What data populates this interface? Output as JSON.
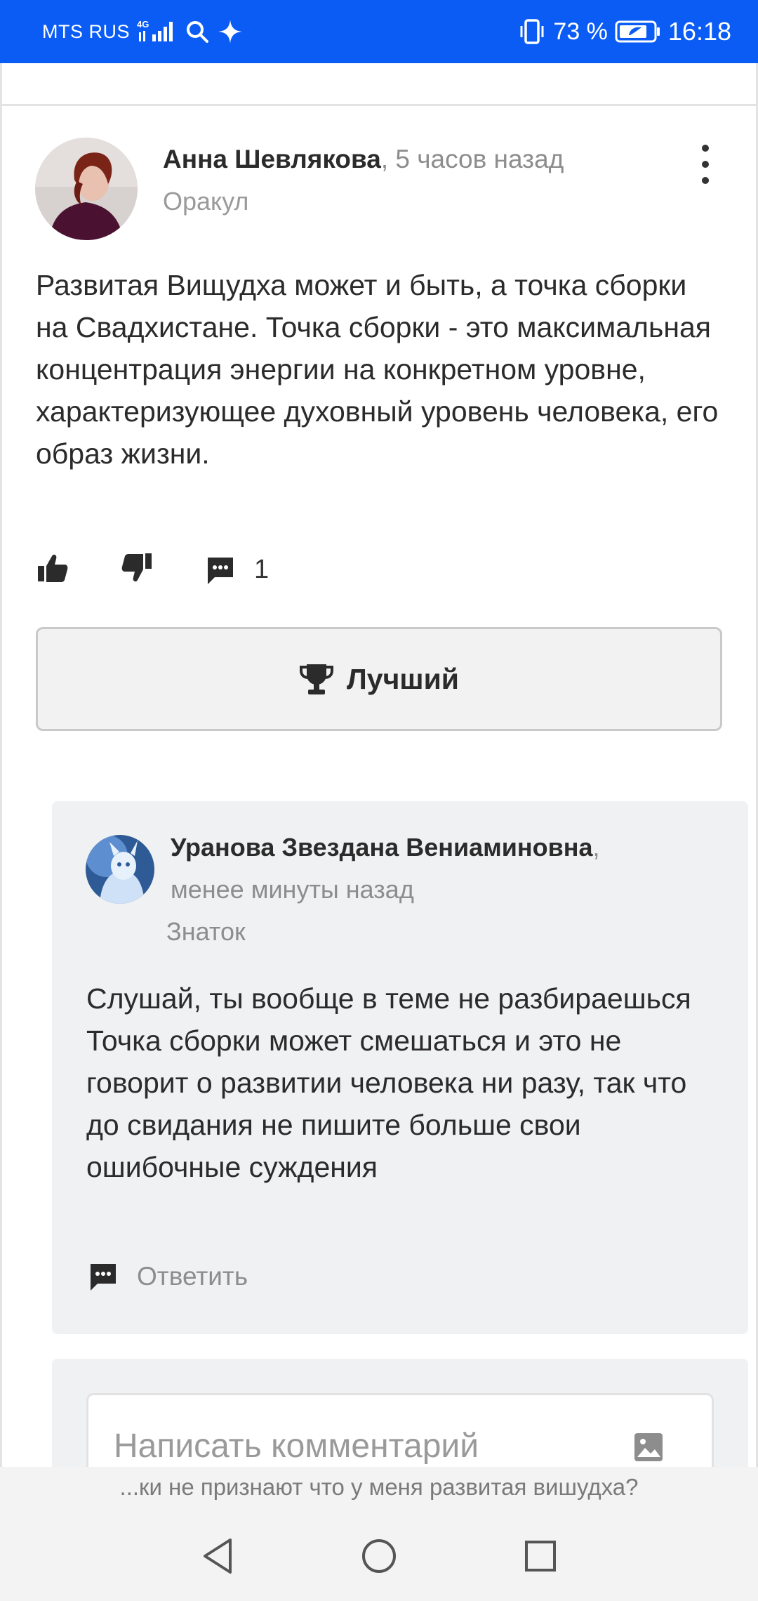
{
  "status_bar": {
    "carrier": "MTS RUS",
    "network": "4G",
    "battery": "73 %",
    "time": "16:18",
    "icons": [
      "signal-icon",
      "search-icon",
      "sparkle-icon",
      "vibrate-icon",
      "battery-icon"
    ]
  },
  "answer": {
    "author": "Анна Шевлякова",
    "time": ", 5 часов назад",
    "rank": "Оракул",
    "text": "Развитая Вищудха может и быть, а точка сборки на Свадхистане. Точка сборки - это максимальная концентрация энергии на конкретном уровне, характеризующее духовный уровень человека, его образ жизни.",
    "comment_count": "1",
    "best_label": "Лучший"
  },
  "comment": {
    "author": "Уранова Звездана Вениаминовна",
    "comma": ",",
    "time": "менее минуты назад",
    "rank": "Знаток",
    "lines": [
      "Слушай, ты вообще в теме не разбираешься",
      "Точка сборки может смешаться и это не говорит о развитии человека ни разу, так что до свидания не пишите больше свои ошибочные суждения"
    ],
    "reply_label": "Ответить"
  },
  "write_comment": {
    "placeholder": "Написать комментарий"
  },
  "footer": {
    "question": "...ки не признают что у меня развитая вишудха?"
  },
  "colors": {
    "status_bar": "#0a5cf5",
    "text": "#2b2b2b",
    "muted": "#8d8d8d",
    "comment_bg": "#f0f1f3"
  }
}
